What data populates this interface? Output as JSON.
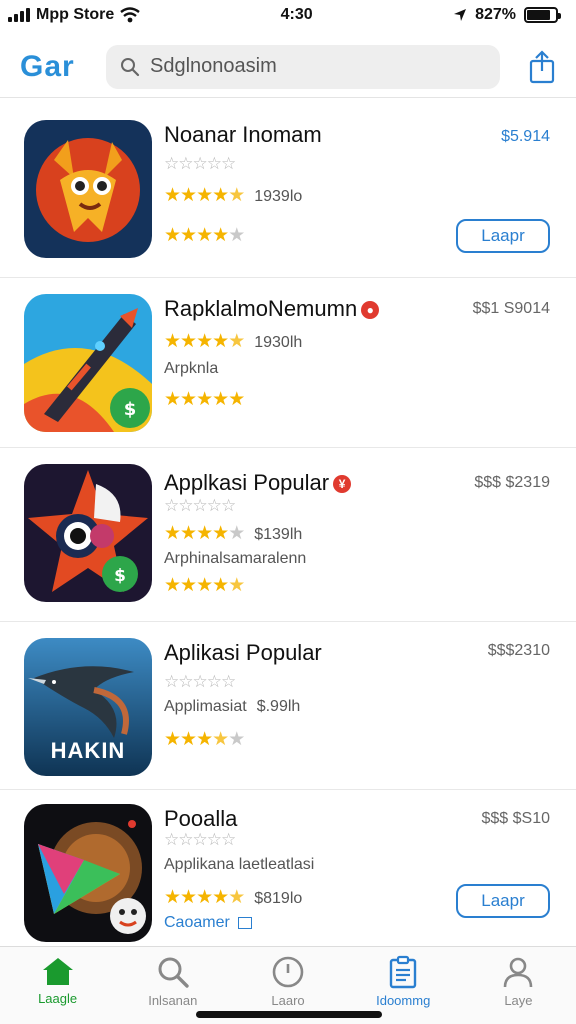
{
  "status": {
    "carrier": "Mpp Store",
    "time": "4:30",
    "battery": "827%",
    "battery_level": 0.82
  },
  "header": {
    "brand": "Gar",
    "search_placeholder": "Sdglnonoasim"
  },
  "apps": [
    {
      "title": "Noanar Inomam",
      "price": "$5.914",
      "rating1": "☆☆☆☆☆",
      "rating2_count": "1939lo",
      "rating2_value": 4.5,
      "rating3_value": 4,
      "button": "Laapr"
    },
    {
      "title": "RapklalmoNemumn",
      "badge": "●",
      "price": "$$1 S9014",
      "rating1_count": "1930lh",
      "rating1_value": 4.5,
      "sub": "Arpknla",
      "rating2_value": 5
    },
    {
      "title": "Applkasi Popular",
      "badge": "¥",
      "price": "$$$ $2319",
      "rating1": "☆☆☆☆☆",
      "rating2_count": "$139lh",
      "rating2_value": 4,
      "sub": "Arphinalsamaralenn",
      "rating3_value": 4.5
    },
    {
      "title": "Aplikasi Popular",
      "price": "$$$2310",
      "rating1": "☆☆☆☆☆",
      "sub": "Applimasiat",
      "sub_count": "$.99lh",
      "rating2_value": 3.5,
      "icon_text": "HAKIN"
    },
    {
      "title": "Pooalla",
      "price": "$$$ $S10",
      "rating1": "☆☆☆☆☆",
      "sub": "Applikana laetleatlasi",
      "rating2_count": "$819lo",
      "rating2_value": 4.5,
      "link": "Caoamer",
      "button": "Laapr"
    }
  ],
  "tabs": [
    {
      "label": "Laagle",
      "icon": "home-icon"
    },
    {
      "label": "Inlsanan",
      "icon": "search-icon"
    },
    {
      "label": "Laaro",
      "icon": "clock-icon"
    },
    {
      "label": "Idoommg",
      "icon": "list-icon"
    },
    {
      "label": "Laye",
      "icon": "person-icon"
    }
  ],
  "colors": {
    "accent": "#2a7fd0",
    "star": "#f5b400",
    "active_tab": "#1a9a2e",
    "badge": "#e03a2f"
  }
}
